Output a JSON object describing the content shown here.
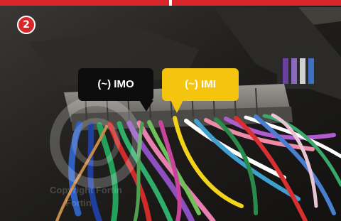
{
  "header": {
    "step_number": "2"
  },
  "callouts": {
    "imo": {
      "label": "(~) IMO",
      "color": "#0d0d0d"
    },
    "imi": {
      "label": "(~) IMI",
      "color": "#f4c40f"
    }
  },
  "brand_colors": {
    "accent_red": "#d9262a"
  },
  "watermark": {
    "line1": "Copyright Fortin",
    "line2": "Fortin"
  }
}
